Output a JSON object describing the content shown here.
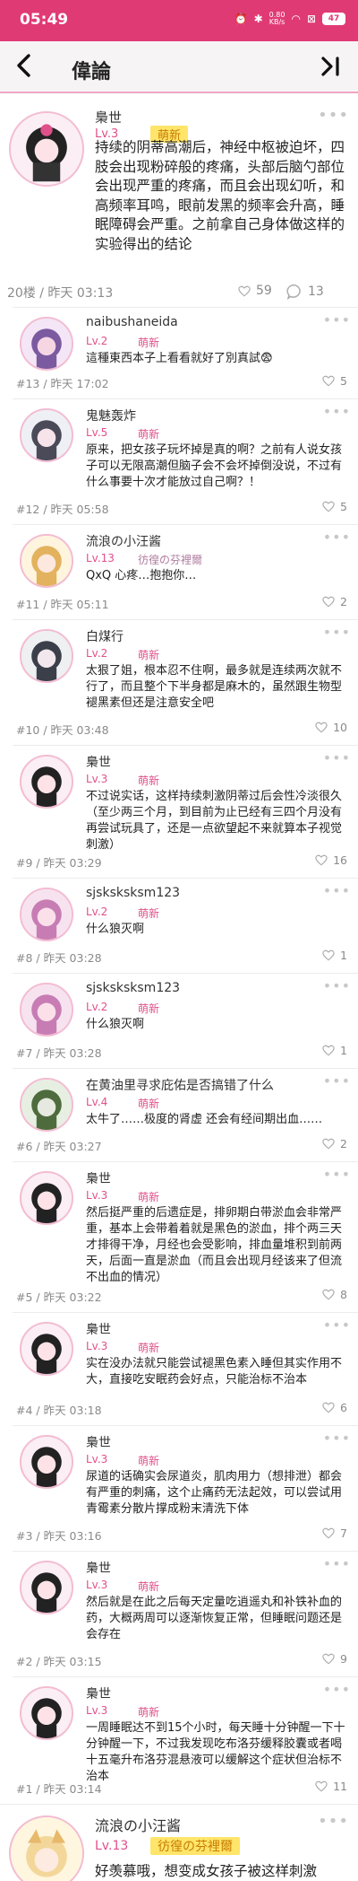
{
  "status_bar": {
    "time": "05:49",
    "speed": "0.80\nKB/s",
    "battery": "47"
  },
  "header": {
    "back_icon": "back-icon",
    "title": "偉論",
    "last_page_icon": "last-page-icon"
  },
  "main_post": {
    "username": "梟世",
    "level": "Lv.3",
    "badge": "萌新",
    "text": "持续的阴蒂高潮后，神经中枢被迫坏，四肢会出现粉碎般的疼痛，头部后脑勺部位会出现严重的疼痛，而且会出现幻听，和高频率耳鸣，眼前发黑的频率会升高，睡眠障碍会严重。之前拿自己身体做这样的实验得出的结论",
    "floor_time": "20楼 / 昨天 03:13",
    "likes": "59",
    "comments": "13"
  },
  "replies": [
    {
      "username": "naibushaneida",
      "level": "Lv.2",
      "badge": "萌新",
      "text": "這種東西本子上看看就好了別真試😨",
      "meta": "#13 / 昨天 17:02",
      "count": "5"
    },
    {
      "username": "鬼魅轰炸",
      "level": "Lv.5",
      "badge": "萌新",
      "text": "原来，把女孩子玩坏掉是真的啊？之前有人说女孩子可以无限高潮但脑子会不会坏掉倒没说，不过有什么事要十次才能放过自己啊？！",
      "meta": "#12 / 昨天 05:58",
      "count": "5"
    },
    {
      "username": "流浪の小汪酱",
      "level": "Lv.13",
      "badge": "彷徨の芬裡爾",
      "text": "QxQ  心疼…抱抱你…",
      "meta": "#11 / 昨天 05:11",
      "count": "2"
    },
    {
      "username": "白煤行",
      "level": "Lv.2",
      "badge": "萌新",
      "text": "太狠了姐，根本忍不住啊，最多就是连续两次就不行了，而且整个下半身都是麻木的，虽然跟生物型褪黑素但还是注意安全吧",
      "meta": "#10 / 昨天 03:48",
      "count": "10"
    },
    {
      "username": "梟世",
      "level": "Lv.3",
      "badge": "萌新",
      "text": "不过说实话，这样持续刺激阴蒂过后会性冷淡很久（至少两三个月，到目前为止已经有三四个月没有再尝试玩具了，还是一点欲望起不来就算本子视觉刺激）",
      "meta": "#9 / 昨天 03:29",
      "count": "16"
    },
    {
      "username": "sjsksksksm123",
      "level": "Lv.2",
      "badge": "萌新",
      "text": "什么狼灭啊",
      "meta": "#8 / 昨天 03:28",
      "count": "1"
    },
    {
      "username": "sjsksksksm123",
      "level": "Lv.2",
      "badge": "萌新",
      "text": "什么狼灭啊",
      "meta": "#7 / 昨天 03:28",
      "count": "1"
    },
    {
      "username": "在黄油里寻求庇佑是否搞错了什么",
      "level": "Lv.4",
      "badge": "萌新",
      "text": "太牛了……极度的肾虚  还会有经间期出血……",
      "meta": "#6 / 昨天 03:27",
      "count": "2"
    },
    {
      "username": "梟世",
      "level": "Lv.3",
      "badge": "萌新",
      "text": "然后挺严重的后遗症是，排卵期白带淤血会非常严重，基本上会带着着就是黑色的淤血，排个两三天才排得干净，月经也会受影响，排血量堆积到前两天，后面一直是淤血（而且会出现月经该来了但流不出血的情况）",
      "meta": "#5 / 昨天 03:22",
      "count": "8"
    },
    {
      "username": "梟世",
      "level": "Lv.3",
      "badge": "萌新",
      "text": "实在没办法就只能尝试褪黑色素入睡但其实作用不大，直接吃安眠药会好点，只能治标不治本",
      "meta": "#4 / 昨天 03:18",
      "count": "6"
    },
    {
      "username": "梟世",
      "level": "Lv.3",
      "badge": "萌新",
      "text": "尿道的话确实会尿道炎，肌肉用力（想排泄）都会有严重的刺痛，这个止痛药无法起效，可以尝试用青霉素分散片撑成粉末清洗下体",
      "meta": "#3 / 昨天 03:16",
      "count": "7"
    },
    {
      "username": "梟世",
      "level": "Lv.3",
      "badge": "萌新",
      "text": "然后就是在此之后每天定量吃逍遥丸和补铁补血的药，大概两周可以逐渐恢复正常，但睡眠问题还是会存在",
      "meta": "#2 / 昨天 03:15",
      "count": "9"
    },
    {
      "username": "梟世",
      "level": "Lv.3",
      "badge": "萌新",
      "text": "一周睡眠达不到15个小时，每天睡十分钟醒一下十分钟醒一下，不过我发现吃布洛芬缓释胶囊或者喝十五毫升布洛芬混悬液可以缓解这个症状但治标不治本",
      "meta": "#1 / 昨天 03:14",
      "count": "11"
    }
  ],
  "bottom_post": {
    "username": "流浪の小汪酱",
    "level": "Lv.13",
    "badge": "彷徨の芬裡爾",
    "text": "好羡慕哦，想变成女孩子被这样刺激"
  }
}
